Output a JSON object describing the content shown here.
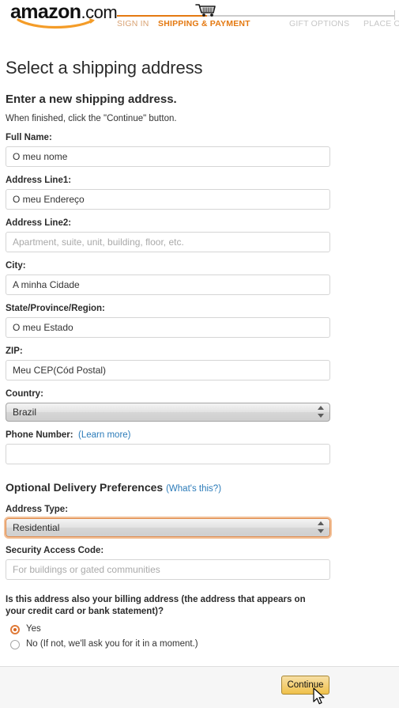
{
  "header": {
    "logo_text": "amazon",
    "logo_suffix": ".com",
    "cart_icon": "shopping-cart-icon",
    "steps": [
      {
        "label": "SIGN IN",
        "state": "done"
      },
      {
        "label": "SHIPPING & PAYMENT",
        "state": "current"
      },
      {
        "label": "GIFT OPTIONS",
        "state": "upcoming"
      },
      {
        "label": "PLACE ORDER",
        "state": "upcoming"
      }
    ],
    "accent_color": "#e47911",
    "inactive_color": "#c6c6c6"
  },
  "page": {
    "title": "Select a shipping address",
    "section_title": "Enter a new shipping address.",
    "sub_note": "When finished, click the \"Continue\" button."
  },
  "form": {
    "full_name": {
      "label": "Full Name:",
      "value": "O meu nome",
      "placeholder": ""
    },
    "address1": {
      "label": "Address Line1:",
      "value": "O meu Endereço",
      "placeholder": ""
    },
    "address2": {
      "label": "Address Line2:",
      "value": "",
      "placeholder": "Apartment, suite, unit, building, floor, etc."
    },
    "city": {
      "label": "City:",
      "value": "A minha Cidade",
      "placeholder": ""
    },
    "state": {
      "label": "State/Province/Region:",
      "value": "O meu Estado",
      "placeholder": ""
    },
    "zip": {
      "label": "ZIP:",
      "value": "Meu CEP(Cód Postal)",
      "placeholder": ""
    },
    "country": {
      "label": "Country:",
      "selected": "Brazil"
    },
    "phone": {
      "label": "Phone Number:",
      "link": "(Learn more)",
      "value": "",
      "placeholder": ""
    }
  },
  "optional": {
    "heading": "Optional Delivery Preferences",
    "heading_link": "(What's this?)",
    "address_type": {
      "label": "Address Type:",
      "selected": "Residential",
      "focused": true,
      "focus_color": "#e08a4a"
    },
    "security_code": {
      "label": "Security Access Code:",
      "value": "",
      "placeholder": "For buildings or gated communities"
    }
  },
  "billing": {
    "question": "Is this address also your billing address (the address that appears on your credit card or bank statement)?",
    "options": [
      {
        "label": "Yes",
        "selected": true
      },
      {
        "label": "No  (If not, we'll ask you for it in a moment.)",
        "selected": false
      }
    ],
    "radio_color": "#d9661f"
  },
  "footer": {
    "continue_label": "Continue",
    "button_color": "#f0c14b",
    "cursor": "mouse-pointer-arrow"
  }
}
